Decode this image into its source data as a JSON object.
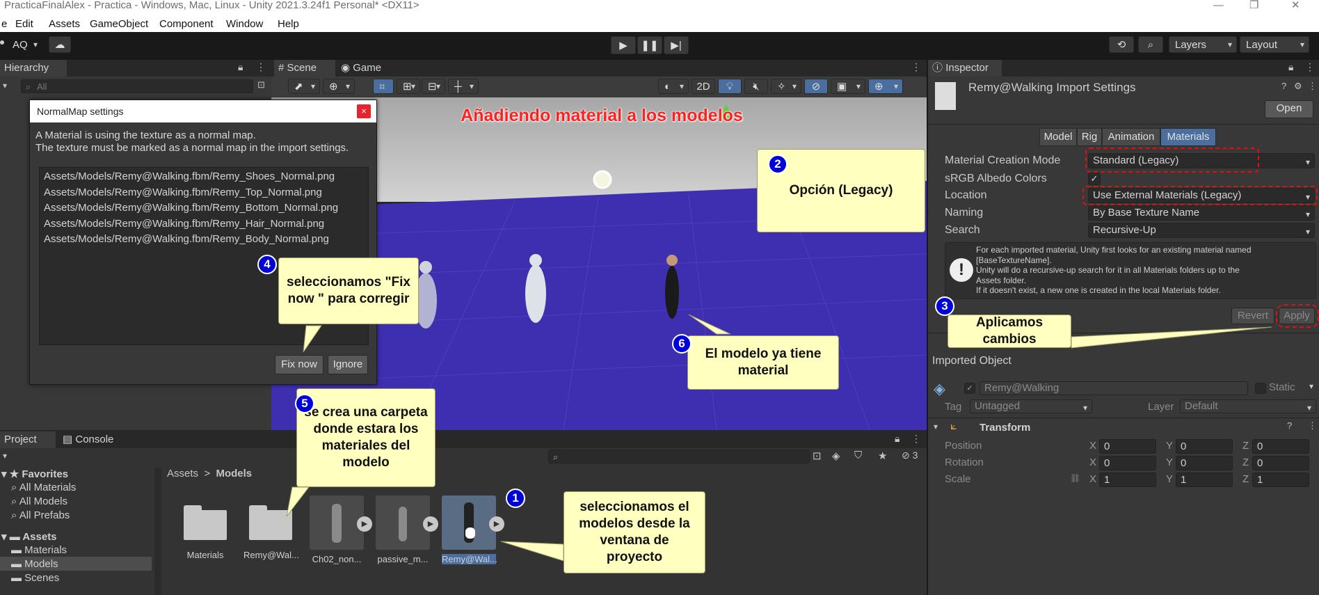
{
  "window": {
    "title": "PracticaFinalAlex - Practica - Windows, Mac, Linux - Unity 2021.3.24f1 Personal* <DX11>"
  },
  "menu": [
    "e",
    "Edit",
    "Assets",
    "GameObject",
    "Component",
    "Window",
    "Help"
  ],
  "toolbar": {
    "account": "AQ",
    "layers": "Layers",
    "layout": "Layout"
  },
  "hierarchy": {
    "tab": "Hierarchy",
    "search_placeholder": "All"
  },
  "scene": {
    "tabs": [
      "Scene",
      "Game"
    ],
    "mode_2d": "2D",
    "heading": "Añadiendo material a los modelos"
  },
  "dialog": {
    "title": "NormalMap settings",
    "close": "×",
    "message_line1": "A Material is using the texture as a normal map.",
    "message_line2": "The texture must be marked as a normal map in the import settings.",
    "files": [
      "Assets/Models/Remy@Walking.fbm/Remy_Shoes_Normal.png",
      "Assets/Models/Remy@Walking.fbm/Remy_Top_Normal.png",
      "Assets/Models/Remy@Walking.fbm/Remy_Bottom_Normal.png",
      "Assets/Models/Remy@Walking.fbm/Remy_Hair_Normal.png",
      "Assets/Models/Remy@Walking.fbm/Remy_Body_Normal.png"
    ],
    "fix_button": "Fix now",
    "ignore_button": "Ignore"
  },
  "callouts": {
    "c1": {
      "num": "1",
      "text": "seleccionamos el modelos desde la ventana de proyecto"
    },
    "c2": {
      "num": "2",
      "text": "Opción (Legacy)"
    },
    "c3": {
      "num": "3",
      "text": "Aplicamos cambios"
    },
    "c4": {
      "num": "4",
      "text": "seleccionamos \"Fix now \" para corregir"
    },
    "c5": {
      "num": "5",
      "text": "se crea una carpeta donde estara los materiales del modelo"
    },
    "c6": {
      "num": "6",
      "text": "El modelo ya tiene material"
    }
  },
  "inspector": {
    "tab": "Inspector",
    "title": "Remy@Walking Import Settings",
    "open_button": "Open",
    "mode_tabs": [
      "Model",
      "Rig",
      "Animation",
      "Materials"
    ],
    "active_mode": "Materials",
    "fields": [
      {
        "label": "Material Creation Mode",
        "value": "Standard (Legacy)"
      },
      {
        "label": "sRGB Albedo Colors",
        "value": "✓"
      },
      {
        "label": "Location",
        "value": "Use External Materials (Legacy)"
      },
      {
        "label": "Naming",
        "value": "By Base Texture Name"
      },
      {
        "label": "Search",
        "value": "Recursive-Up"
      }
    ],
    "info_lines": [
      "For each imported material, Unity first looks for an existing material named",
      "[BaseTextureName].",
      "Unity will do a recursive-up search for it in all Materials folders up to the",
      "Assets folder.",
      "If it doesn't exist, a new one is created in the local Materials folder."
    ],
    "revert_button": "Revert",
    "apply_button": "Apply",
    "imported_object": "Imported Object",
    "object_name": "Remy@Walking",
    "static_label": "Static",
    "tag_label": "Tag",
    "tag_value": "Untagged",
    "layer_label": "Layer",
    "layer_value": "Default",
    "transform": "Transform",
    "position_label": "Position",
    "rotation_label": "Rotation",
    "scale_label": "Scale",
    "position": [
      "0",
      "0",
      "0"
    ],
    "rotation": [
      "0",
      "0",
      "0"
    ],
    "scale": [
      "1",
      "1",
      "1"
    ],
    "axes": [
      "X",
      "Y",
      "Z"
    ]
  },
  "project": {
    "tabs": [
      "Project",
      "Console"
    ],
    "hidden_count": "3",
    "tree": {
      "favorites": "Favorites",
      "fav_items": [
        "All Materials",
        "All Models",
        "All Prefabs"
      ],
      "assets": "Assets",
      "asset_items": [
        "Materials",
        "Models",
        "Scenes"
      ]
    },
    "breadcrumb": [
      "Assets",
      "Models"
    ],
    "assets": [
      "Materials",
      "Remy@Wal...",
      "Ch02_non...",
      "passive_m...",
      "Remy@Wal..."
    ]
  },
  "colors": {
    "scene_floor": "#3e2fb0",
    "sky": "#b8b8b8",
    "callout_bg": "#ffffc0",
    "badge": "#0000d8",
    "heading_red": "#ff2020",
    "selected": "#4a6e9e"
  }
}
